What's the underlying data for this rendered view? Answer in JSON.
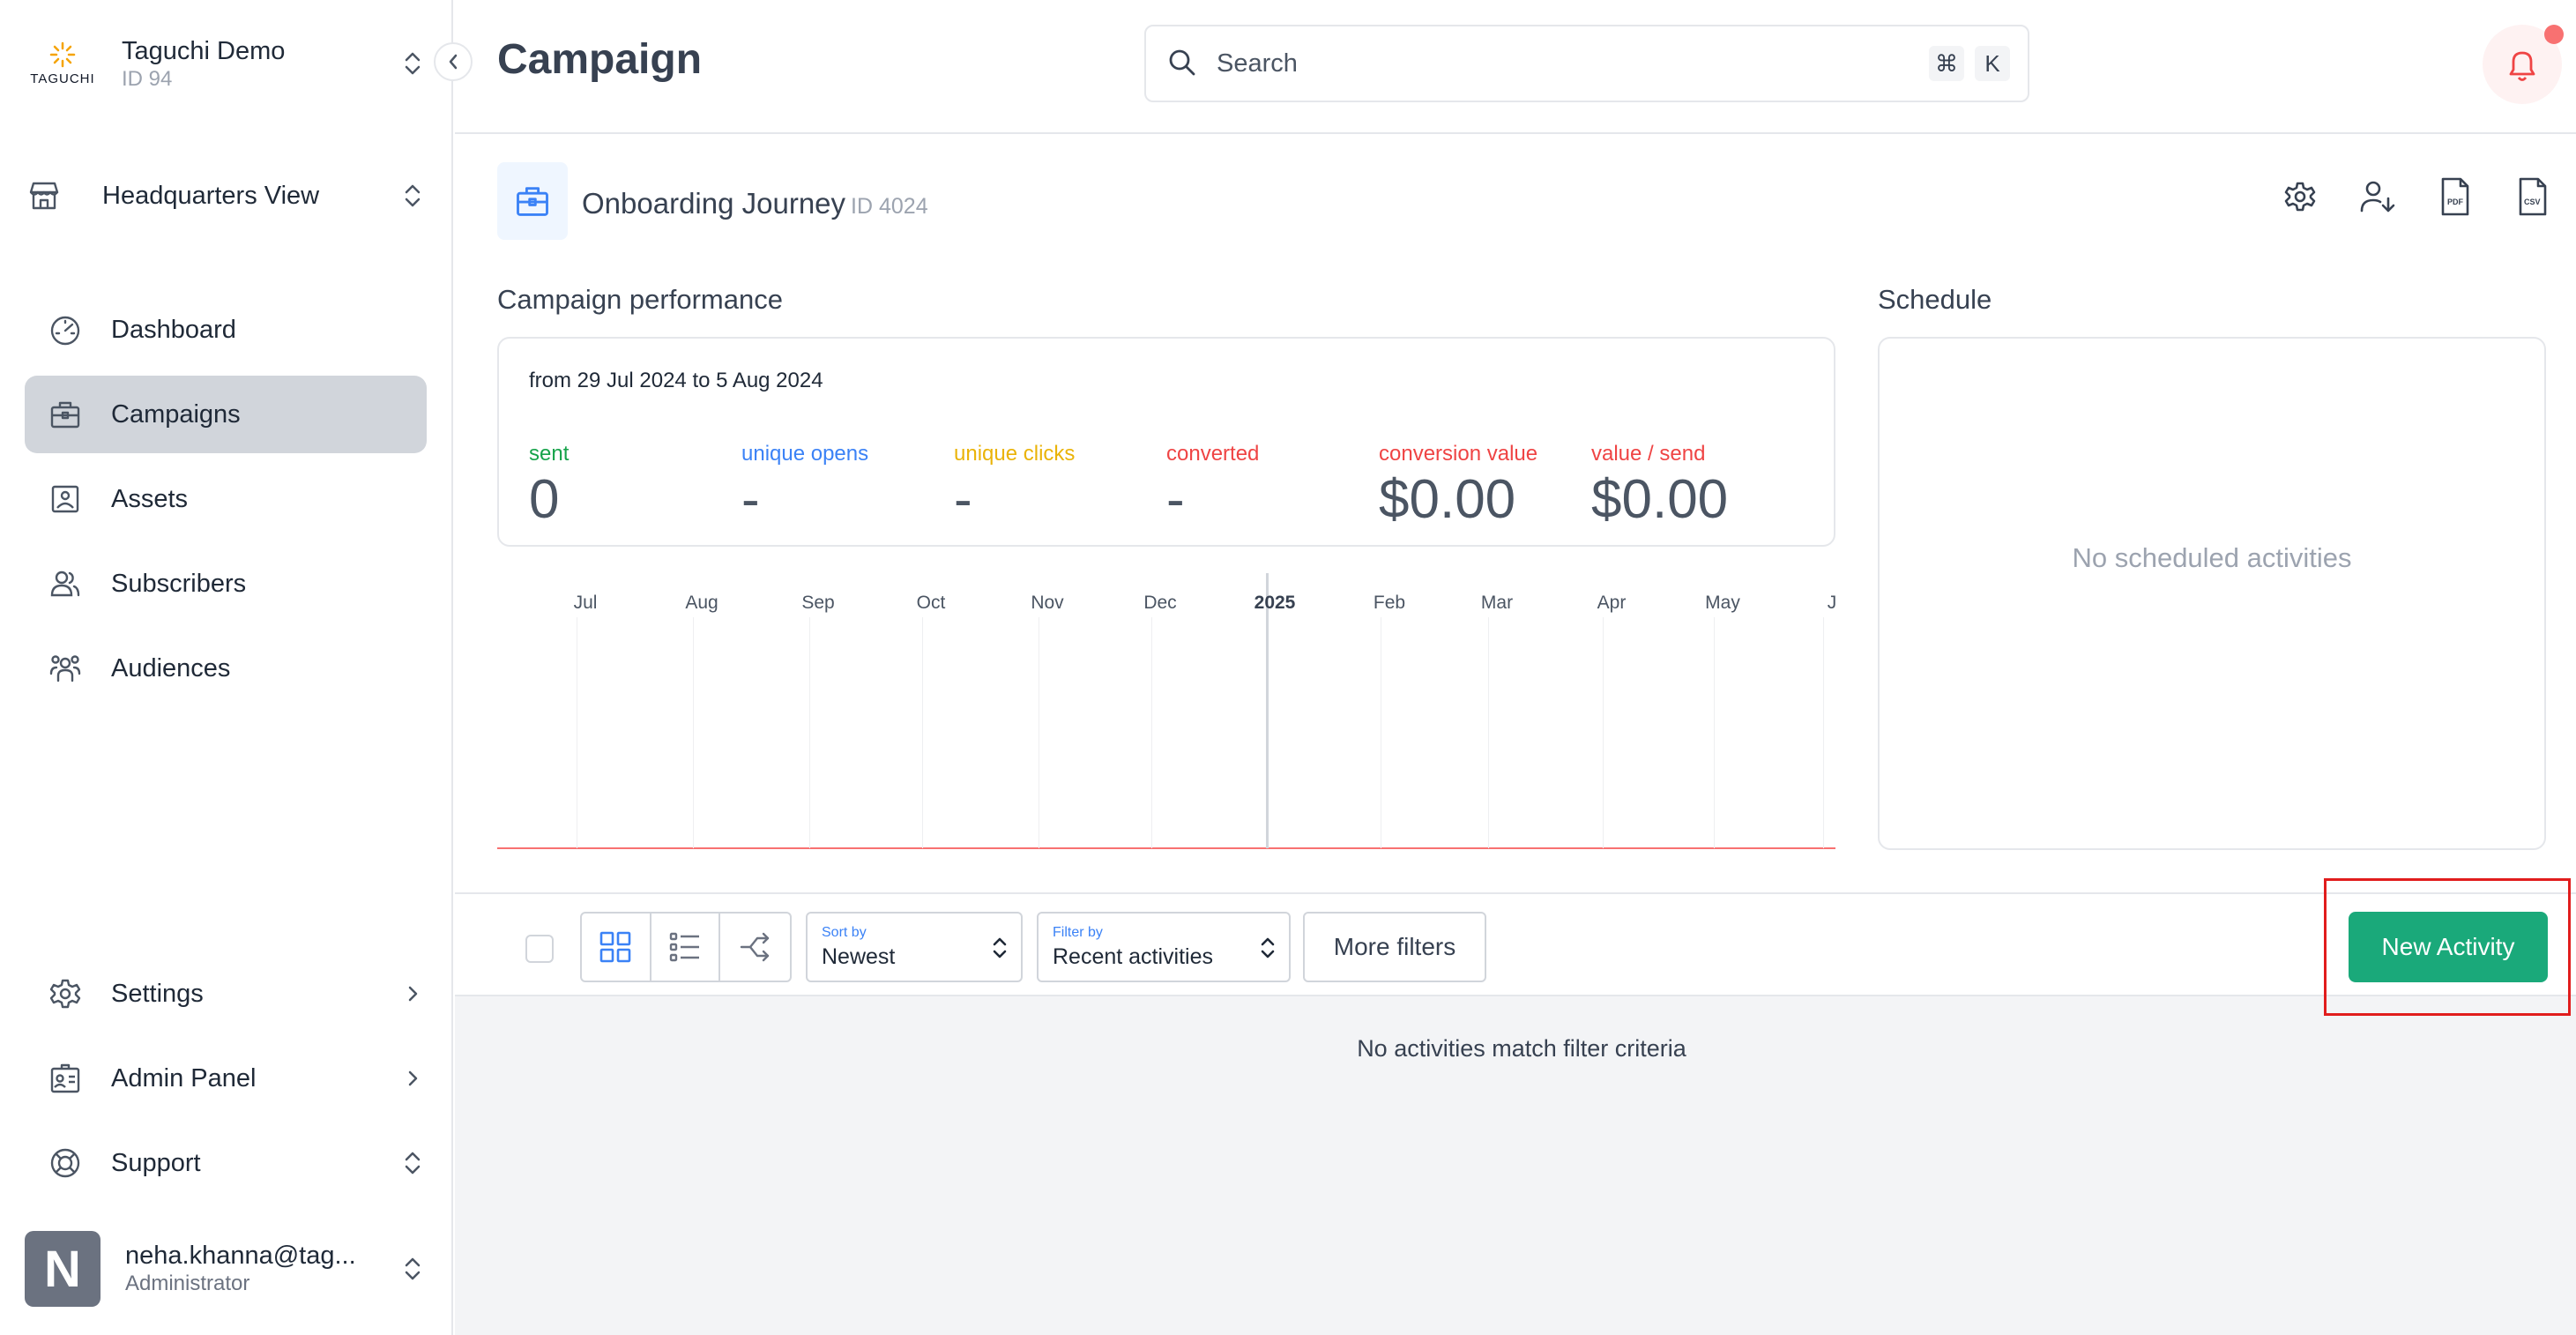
{
  "org": {
    "name": "Taguchi Demo",
    "id_label": "ID 94",
    "logo_text": "TAGUCHI"
  },
  "workspace": {
    "label": "Headquarters View"
  },
  "nav": {
    "items": [
      {
        "label": "Dashboard",
        "icon": "gauge-icon",
        "active": false
      },
      {
        "label": "Campaigns",
        "icon": "briefcase-icon",
        "active": true
      },
      {
        "label": "Assets",
        "icon": "image-icon",
        "active": false
      },
      {
        "label": "Subscribers",
        "icon": "users-icon",
        "active": false
      },
      {
        "label": "Audiences",
        "icon": "group-icon",
        "active": false
      }
    ],
    "bottom": [
      {
        "label": "Settings",
        "icon": "gear-icon",
        "trailing": "chevron-right"
      },
      {
        "label": "Admin Panel",
        "icon": "id-card-icon",
        "trailing": "chevron-right"
      },
      {
        "label": "Support",
        "icon": "lifebuoy-icon",
        "trailing": "updown"
      }
    ]
  },
  "user": {
    "initial": "N",
    "email": "neha.khanna@tag...",
    "role": "Administrator"
  },
  "header": {
    "title": "Campaign",
    "search_placeholder": "Search",
    "shortcut_modifier": "⌘",
    "shortcut_key": "K"
  },
  "campaign": {
    "name": "Onboarding Journey",
    "id_label": "ID 4024"
  },
  "performance": {
    "title": "Campaign performance",
    "range": "from 29 Jul 2024 to 5 Aug 2024",
    "metrics": [
      {
        "label": "sent",
        "value": "0",
        "color": "#16a34a"
      },
      {
        "label": "unique opens",
        "value": "-",
        "color": "#3b82f6"
      },
      {
        "label": "unique clicks",
        "value": "-",
        "color": "#eab308"
      },
      {
        "label": "converted",
        "value": "-",
        "color": "#ef4444"
      },
      {
        "label": "conversion value",
        "value": "$0.00",
        "color": "#ef4444"
      },
      {
        "label": "value / send",
        "value": "$0.00",
        "color": "#ef4444"
      }
    ],
    "timeline_months": [
      "Jul",
      "Aug",
      "Sep",
      "Oct",
      "Nov",
      "Dec",
      "2025",
      "Feb",
      "Mar",
      "Apr",
      "May",
      "J"
    ]
  },
  "schedule": {
    "title": "Schedule",
    "empty_text": "No scheduled activities"
  },
  "filters": {
    "sort_caption": "Sort by",
    "sort_value": "Newest",
    "filter_caption": "Filter by",
    "filter_value": "Recent activities",
    "more_filters_label": "More filters",
    "new_activity_label": "New Activity"
  },
  "activities": {
    "empty_text": "No activities match filter criteria"
  },
  "colors": {
    "accent_green": "#1aa97a",
    "active_nav": "#d1d5db",
    "highlight": "#e11d1d"
  }
}
